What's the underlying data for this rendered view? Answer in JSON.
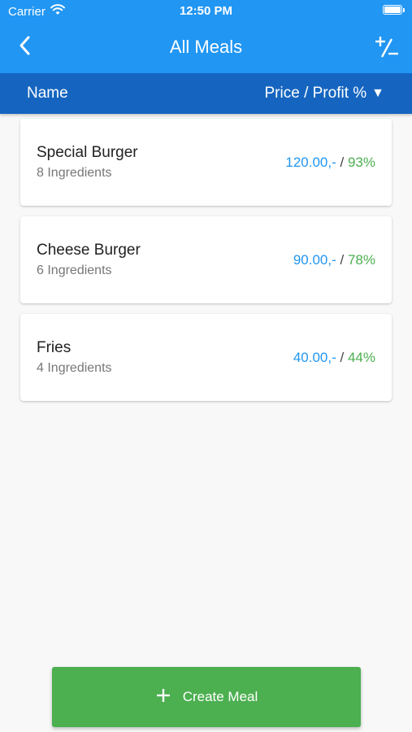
{
  "status_bar": {
    "carrier": "Carrier",
    "time": "12:50 PM",
    "wifi_icon": "wifi-icon",
    "battery_icon": "battery-icon",
    "battery_level": 1.0
  },
  "app_bar": {
    "title": "All Meals",
    "back_icon": "chevron-left-icon",
    "plus_minus_icon": "plus-minus-icon"
  },
  "header": {
    "name_label": "Name",
    "sort_label": "Price / Profit %",
    "sort_arrow": "▼"
  },
  "meals": [
    {
      "name": "Special Burger",
      "ingredients": "8 Ingredients",
      "price": "120.00,-",
      "separator": "/",
      "profit": "93%"
    },
    {
      "name": "Cheese Burger",
      "ingredients": "6 Ingredients",
      "price": "90.00,-",
      "separator": "/",
      "profit": "78%"
    },
    {
      "name": "Fries",
      "ingredients": "4 Ingredients",
      "price": "40.00,-",
      "separator": "/",
      "profit": "44%"
    }
  ],
  "create_button": {
    "label": "Create Meal",
    "icon": "plus-icon"
  },
  "colors": {
    "app_bar": "#2196f3",
    "header_row": "#1565c0",
    "price": "#2196f3",
    "profit": "#4caf50",
    "create_button": "#4caf50"
  }
}
